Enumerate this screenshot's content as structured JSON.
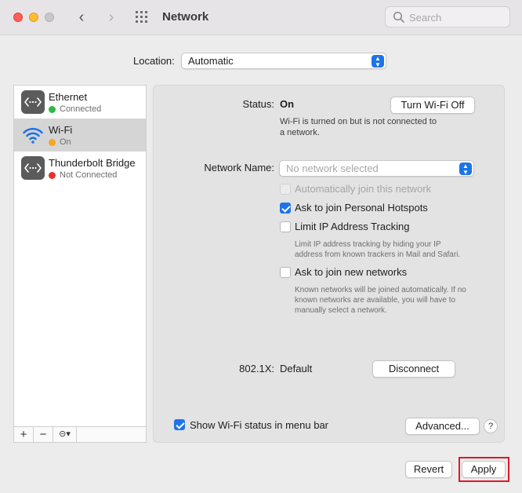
{
  "window": {
    "title": "Network"
  },
  "search": {
    "placeholder": "Search"
  },
  "location": {
    "label": "Location:",
    "value": "Automatic"
  },
  "services": [
    {
      "name": "Ethernet",
      "status": "Connected",
      "status_color": "#2fb845",
      "icon": "ethernet-icon"
    },
    {
      "name": "Wi-Fi",
      "status": "On",
      "status_color": "#f5a623",
      "icon": "wifi-icon",
      "selected": true
    },
    {
      "name": "Thunderbolt Bridge",
      "status": "Not Connected",
      "status_color": "#e5322d",
      "icon": "ethernet-icon"
    }
  ],
  "sidebar_toolbar": {
    "add": "+",
    "remove": "−",
    "action": "⊝▾"
  },
  "detail": {
    "status_label": "Status:",
    "status_value": "On",
    "turn_off_button": "Turn Wi-Fi Off",
    "status_desc_line1": "Wi-Fi is turned on but is not connected to",
    "status_desc_line2": "a network.",
    "network_name_label": "Network Name:",
    "network_name_placeholder": "No network selected",
    "auto_join_label": "Automatically join this network",
    "hotspots_label": "Ask to join Personal Hotspots",
    "limit_ip_label": "Limit IP Address Tracking",
    "limit_ip_desc_line1": "Limit IP address tracking by hiding your IP",
    "limit_ip_desc_line2": "address from known trackers in Mail and Safari.",
    "new_networks_label": "Ask to join new networks",
    "new_networks_desc_line1": "Known networks will be joined automatically. If no",
    "new_networks_desc_line2": "known networks are available, you will have to",
    "new_networks_desc_line3": "manually select a network.",
    "dot1x_label": "802.1X:",
    "dot1x_value": "Default",
    "disconnect_button": "Disconnect",
    "show_status_label": "Show Wi-Fi status in menu bar",
    "advanced_button": "Advanced...",
    "help_button": "?"
  },
  "checkboxes": {
    "auto_join": false,
    "hotspots": true,
    "limit_ip": false,
    "new_networks": false,
    "show_status": true
  },
  "footer": {
    "revert_button": "Revert",
    "apply_button": "Apply"
  },
  "colors": {
    "accent": "#1f73e8",
    "highlight_box": "#e0162b"
  }
}
